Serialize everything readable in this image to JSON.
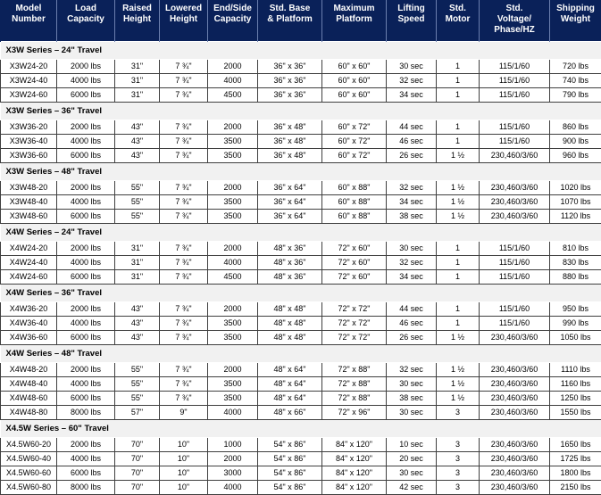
{
  "table": {
    "columns": [
      {
        "key": "model",
        "lines": [
          "Model",
          "Number"
        ]
      },
      {
        "key": "load",
        "lines": [
          "Load",
          "Capacity"
        ]
      },
      {
        "key": "raised",
        "lines": [
          "Raised",
          "Height"
        ]
      },
      {
        "key": "lowered",
        "lines": [
          "Lowered",
          "Height"
        ]
      },
      {
        "key": "endside",
        "lines": [
          "End/Side",
          "Capacity"
        ]
      },
      {
        "key": "base",
        "lines": [
          "Std. Base",
          "& Platform"
        ]
      },
      {
        "key": "maxplat",
        "lines": [
          "Maximum",
          "Platform"
        ]
      },
      {
        "key": "speed",
        "lines": [
          "Lifting",
          "Speed"
        ]
      },
      {
        "key": "motor",
        "lines": [
          "Std.",
          "Motor"
        ]
      },
      {
        "key": "voltage",
        "lines": [
          "Std.",
          "Voltage/",
          "Phase/HZ"
        ]
      },
      {
        "key": "weight",
        "lines": [
          "Shipping",
          "Weight"
        ]
      }
    ],
    "sections": [
      {
        "title": "X3W Series – 24\" Travel",
        "rows": [
          [
            "X3W24-20",
            "2000 lbs",
            "31\"",
            "7 ¾\"",
            "2000",
            "36\" x 36\"",
            "60\" x 60\"",
            "30 sec",
            "1",
            "115/1/60",
            "720 lbs"
          ],
          [
            "X3W24-40",
            "4000 lbs",
            "31\"",
            "7 ¾\"",
            "4000",
            "36\" x 36\"",
            "60\" x 60\"",
            "32 sec",
            "1",
            "115/1/60",
            "740 lbs"
          ],
          [
            "X3W24-60",
            "6000 lbs",
            "31\"",
            "7 ¾\"",
            "4500",
            "36\" x 36\"",
            "60\" x 60\"",
            "34 sec",
            "1",
            "115/1/60",
            "790 lbs"
          ]
        ]
      },
      {
        "title": "X3W Series – 36\" Travel",
        "rows": [
          [
            "X3W36-20",
            "2000 lbs",
            "43\"",
            "7 ¾\"",
            "2000",
            "36\" x 48\"",
            "60\" x 72\"",
            "44 sec",
            "1",
            "115/1/60",
            "860 lbs"
          ],
          [
            "X3W36-40",
            "4000 lbs",
            "43\"",
            "7 ¾\"",
            "3500",
            "36\" x 48\"",
            "60\" x 72\"",
            "46 sec",
            "1",
            "115/1/60",
            "900 lbs"
          ],
          [
            "X3W36-60",
            "6000 lbs",
            "43\"",
            "7 ¾\"",
            "3500",
            "36\" x 48\"",
            "60\" x 72\"",
            "26 sec",
            "1 ½",
            "230,460/3/60",
            "960 lbs"
          ]
        ]
      },
      {
        "title": "X3W Series – 48\" Travel",
        "rows": [
          [
            "X3W48-20",
            "2000 lbs",
            "55\"",
            "7 ¾\"",
            "2000",
            "36\" x 64\"",
            "60\" x 88\"",
            "32 sec",
            "1 ½",
            "230,460/3/60",
            "1020 lbs"
          ],
          [
            "X3W48-40",
            "4000 lbs",
            "55\"",
            "7 ¾\"",
            "3500",
            "36\" x 64\"",
            "60\" x 88\"",
            "34 sec",
            "1 ½",
            "230,460/3/60",
            "1070 lbs"
          ],
          [
            "X3W48-60",
            "6000 lbs",
            "55\"",
            "7 ¾\"",
            "3500",
            "36\" x 64\"",
            "60\" x 88\"",
            "38 sec",
            "1 ½",
            "230,460/3/60",
            "1120 lbs"
          ]
        ]
      },
      {
        "title": "X4W Series – 24\" Travel",
        "rows": [
          [
            "X4W24-20",
            "2000 lbs",
            "31\"",
            "7 ¾\"",
            "2000",
            "48\" x 36\"",
            "72\" x 60\"",
            "30 sec",
            "1",
            "115/1/60",
            "810 lbs"
          ],
          [
            "X4W24-40",
            "4000 lbs",
            "31\"",
            "7 ¾\"",
            "4000",
            "48\" x 36\"",
            "72\" x 60\"",
            "32 sec",
            "1",
            "115/1/60",
            "830 lbs"
          ],
          [
            "X4W24-60",
            "6000 lbs",
            "31\"",
            "7 ¾\"",
            "4500",
            "48\" x 36\"",
            "72\" x 60\"",
            "34 sec",
            "1",
            "115/1/60",
            "880 lbs"
          ]
        ]
      },
      {
        "title": "X4W Series – 36\" Travel",
        "rows": [
          [
            "X4W36-20",
            "2000 lbs",
            "43\"",
            "7 ¾\"",
            "2000",
            "48\" x 48\"",
            "72\" x 72\"",
            "44 sec",
            "1",
            "115/1/60",
            "950 lbs"
          ],
          [
            "X4W36-40",
            "4000 lbs",
            "43\"",
            "7 ¾\"",
            "3500",
            "48\" x 48\"",
            "72\" x 72\"",
            "46 sec",
            "1",
            "115/1/60",
            "990 lbs"
          ],
          [
            "X4W36-60",
            "6000 lbs",
            "43\"",
            "7 ¾\"",
            "3500",
            "48\" x 48\"",
            "72\" x 72\"",
            "26 sec",
            "1 ½",
            "230,460/3/60",
            "1050 lbs"
          ]
        ]
      },
      {
        "title": "X4W Series – 48\" Travel",
        "rows": [
          [
            "X4W48-20",
            "2000 lbs",
            "55\"",
            "7 ¾\"",
            "2000",
            "48\" x 64\"",
            "72\" x 88\"",
            "32 sec",
            "1 ½",
            "230,460/3/60",
            "1110 lbs"
          ],
          [
            "X4W48-40",
            "4000 lbs",
            "55\"",
            "7 ¾\"",
            "3500",
            "48\" x 64\"",
            "72\" x 88\"",
            "30 sec",
            "1 ½",
            "230,460/3/60",
            "1160 lbs"
          ],
          [
            "X4W48-60",
            "6000 lbs",
            "55\"",
            "7 ¾\"",
            "3500",
            "48\" x 64\"",
            "72\" x 88\"",
            "38 sec",
            "1 ½",
            "230,460/3/60",
            "1250 lbs"
          ],
          [
            "X4W48-80",
            "8000 lbs",
            "57\"",
            "9\"",
            "4000",
            "48\" x 66\"",
            "72\" x 96\"",
            "30 sec",
            "3",
            "230,460/3/60",
            "1550 lbs"
          ]
        ]
      },
      {
        "title": "X4.5W Series – 60\" Travel",
        "rows": [
          [
            "X4.5W60-20",
            "2000 lbs",
            "70\"",
            "10\"",
            "1000",
            "54\" x 86\"",
            "84\" x 120\"",
            "10 sec",
            "3",
            "230,460/3/60",
            "1650 lbs"
          ],
          [
            "X4.5W60-40",
            "4000 lbs",
            "70\"",
            "10\"",
            "2000",
            "54\" x 86\"",
            "84\" x 120\"",
            "20 sec",
            "3",
            "230,460/3/60",
            "1725 lbs"
          ],
          [
            "X4.5W60-60",
            "6000 lbs",
            "70\"",
            "10\"",
            "3000",
            "54\" x 86\"",
            "84\" x 120\"",
            "30 sec",
            "3",
            "230,460/3/60",
            "1800 lbs"
          ],
          [
            "X4.5W60-80",
            "8000 lbs",
            "70\"",
            "10\"",
            "4000",
            "54\" x 86\"",
            "84\" x 120\"",
            "42 sec",
            "3",
            "230,460/3/60",
            "2150 lbs"
          ]
        ]
      }
    ]
  },
  "colors": {
    "header_bg": "#0a2159",
    "header_text": "#ffffff",
    "section_bg": "#f1f1f1",
    "cell_border": "#3f3f3f",
    "page_bg": "#ffffff"
  }
}
